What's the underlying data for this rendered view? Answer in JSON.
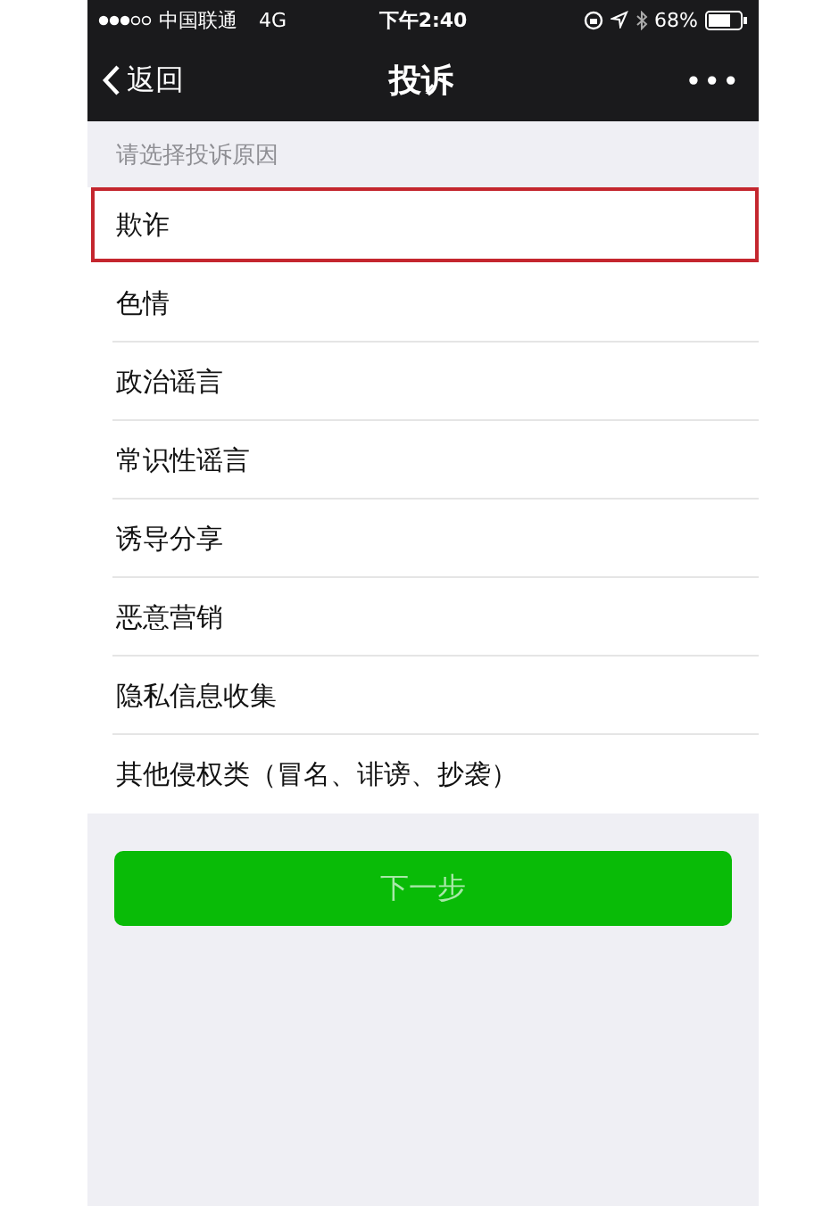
{
  "status_bar": {
    "carrier": "中国联通",
    "network": "4G",
    "time": "下午2:40",
    "battery": "68%"
  },
  "nav_bar": {
    "back": "返回",
    "title": "投诉",
    "more": "•••"
  },
  "section_header": "请选择投诉原因",
  "reasons": [
    {
      "label": "欺诈",
      "selected": true
    },
    {
      "label": "色情",
      "selected": false
    },
    {
      "label": "政治谣言",
      "selected": false
    },
    {
      "label": "常识性谣言",
      "selected": false
    },
    {
      "label": "诱导分享",
      "selected": false
    },
    {
      "label": "恶意营销",
      "selected": false
    },
    {
      "label": "隐私信息收集",
      "selected": false
    },
    {
      "label": "其他侵权类（冒名、诽谤、抄袭）",
      "selected": false
    }
  ],
  "next_button": "下一步"
}
